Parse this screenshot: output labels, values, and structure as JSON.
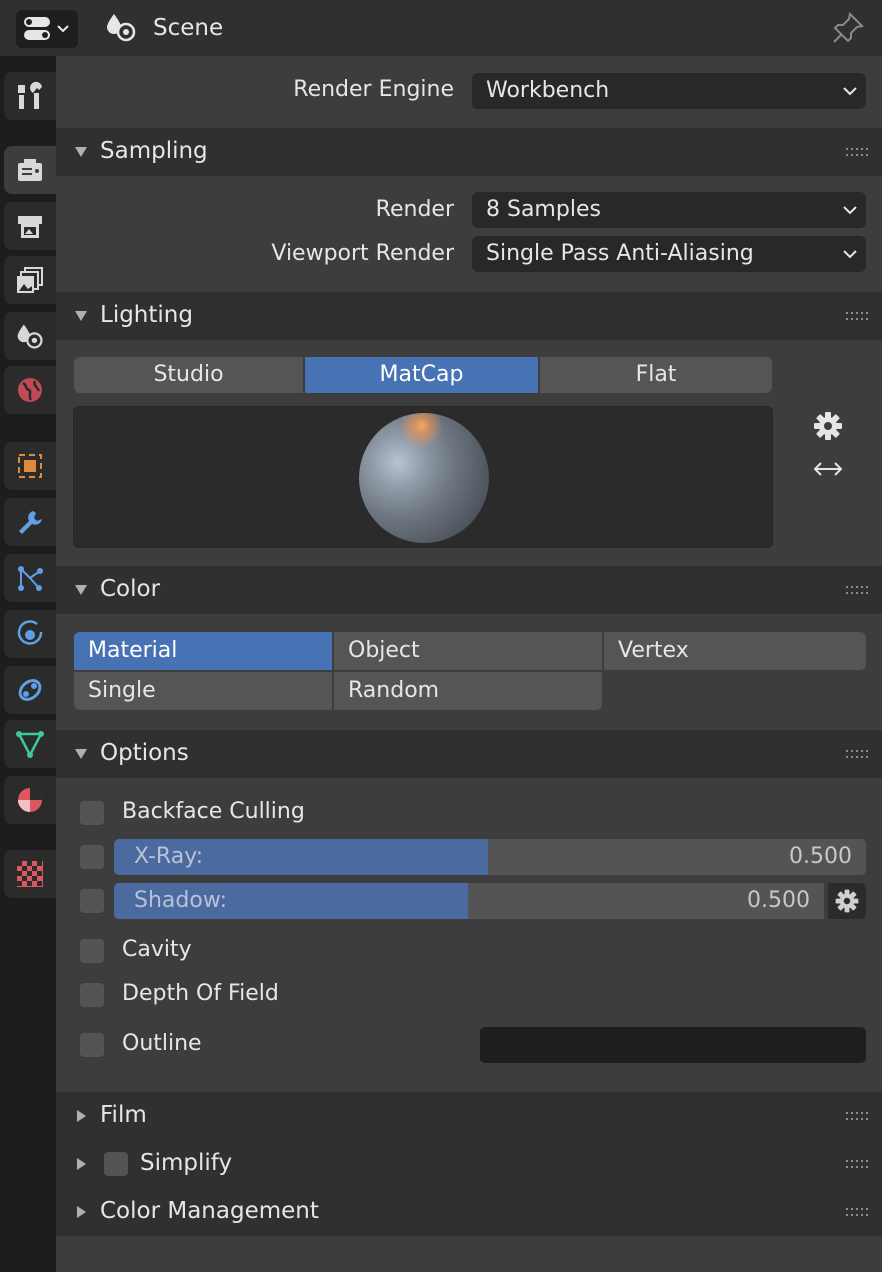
{
  "header": {
    "title": "Scene"
  },
  "tabs": [
    {
      "name": "tool",
      "icon": "tool-icon"
    },
    {
      "name": "render",
      "icon": "render-icon"
    },
    {
      "name": "output",
      "icon": "output-icon"
    },
    {
      "name": "view-layer",
      "icon": "view-layer-icon"
    },
    {
      "name": "scene",
      "icon": "scene-icon"
    },
    {
      "name": "world",
      "icon": "world-icon"
    },
    {
      "name": "object",
      "icon": "object-icon"
    },
    {
      "name": "modifiers",
      "icon": "wrench-icon"
    },
    {
      "name": "particles",
      "icon": "particles-icon"
    },
    {
      "name": "physics",
      "icon": "physics-icon"
    },
    {
      "name": "constraints",
      "icon": "constraints-icon"
    },
    {
      "name": "data",
      "icon": "mesh-data-icon"
    },
    {
      "name": "material",
      "icon": "material-icon"
    },
    {
      "name": "texture",
      "icon": "texture-icon"
    }
  ],
  "render_engine": {
    "label": "Render Engine",
    "value": "Workbench"
  },
  "sampling": {
    "title": "Sampling",
    "render_label": "Render",
    "render_value": "8 Samples",
    "viewport_label": "Viewport Render",
    "viewport_value": "Single Pass Anti-Aliasing"
  },
  "lighting": {
    "title": "Lighting",
    "modes": [
      "Studio",
      "MatCap",
      "Flat"
    ],
    "selected": "MatCap"
  },
  "color": {
    "title": "Color",
    "row1": [
      "Material",
      "Object",
      "Vertex"
    ],
    "row2": [
      "Single",
      "Random"
    ],
    "selected": "Material"
  },
  "options": {
    "title": "Options",
    "backface_culling": "Backface Culling",
    "xray_label": "X-Ray:",
    "xray_value": "0.500",
    "shadow_label": "Shadow:",
    "shadow_value": "0.500",
    "cavity": "Cavity",
    "depth_of_field": "Depth Of Field",
    "outline": "Outline",
    "outline_color": "#1e1e1e"
  },
  "collapsed": {
    "film": "Film",
    "simplify": "Simplify",
    "color_management": "Color Management"
  },
  "colors": {
    "accent": "#4772b3",
    "slider_fill": "#4a6aa0",
    "panel_bg": "#3d3d3d"
  }
}
